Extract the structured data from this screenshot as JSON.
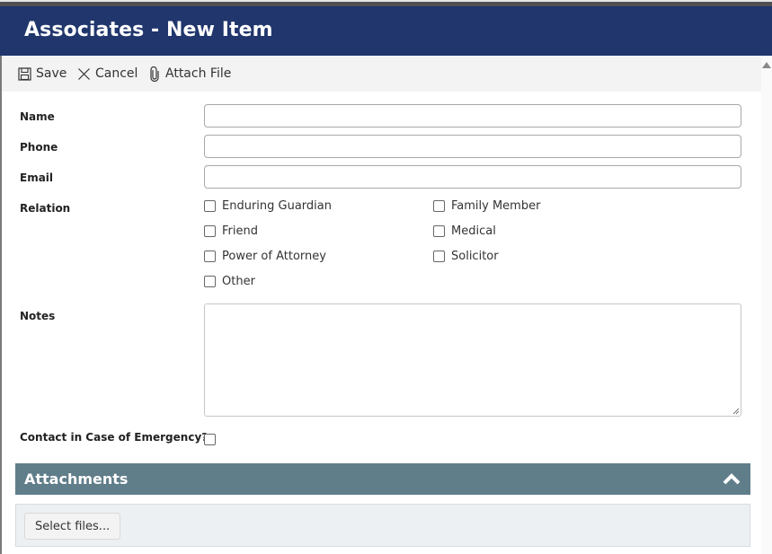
{
  "header": {
    "title": "Associates - New Item"
  },
  "toolbar": {
    "save_label": "Save",
    "cancel_label": "Cancel",
    "attach_label": "Attach File"
  },
  "form": {
    "name": {
      "label": "Name",
      "value": "",
      "placeholder": ""
    },
    "phone": {
      "label": "Phone",
      "value": "",
      "placeholder": ""
    },
    "email": {
      "label": "Email",
      "value": "",
      "placeholder": ""
    },
    "relation": {
      "label": "Relation",
      "options": [
        {
          "label": "Enduring Guardian",
          "checked": false
        },
        {
          "label": "Family Member",
          "checked": false
        },
        {
          "label": "Friend",
          "checked": false
        },
        {
          "label": "Medical",
          "checked": false
        },
        {
          "label": "Power of Attorney",
          "checked": false
        },
        {
          "label": "Solicitor",
          "checked": false
        },
        {
          "label": "Other",
          "checked": false
        }
      ]
    },
    "notes": {
      "label": "Notes",
      "value": ""
    },
    "emergency": {
      "label": "Contact in Case of Emergency?",
      "checked": false
    }
  },
  "attachments": {
    "title": "Attachments",
    "select_files_label": "Select files...",
    "collapse_icon": "chevron-up-icon"
  },
  "icons": {
    "save": "floppy-disk-icon",
    "cancel": "close-icon",
    "attach": "paperclip-icon"
  }
}
